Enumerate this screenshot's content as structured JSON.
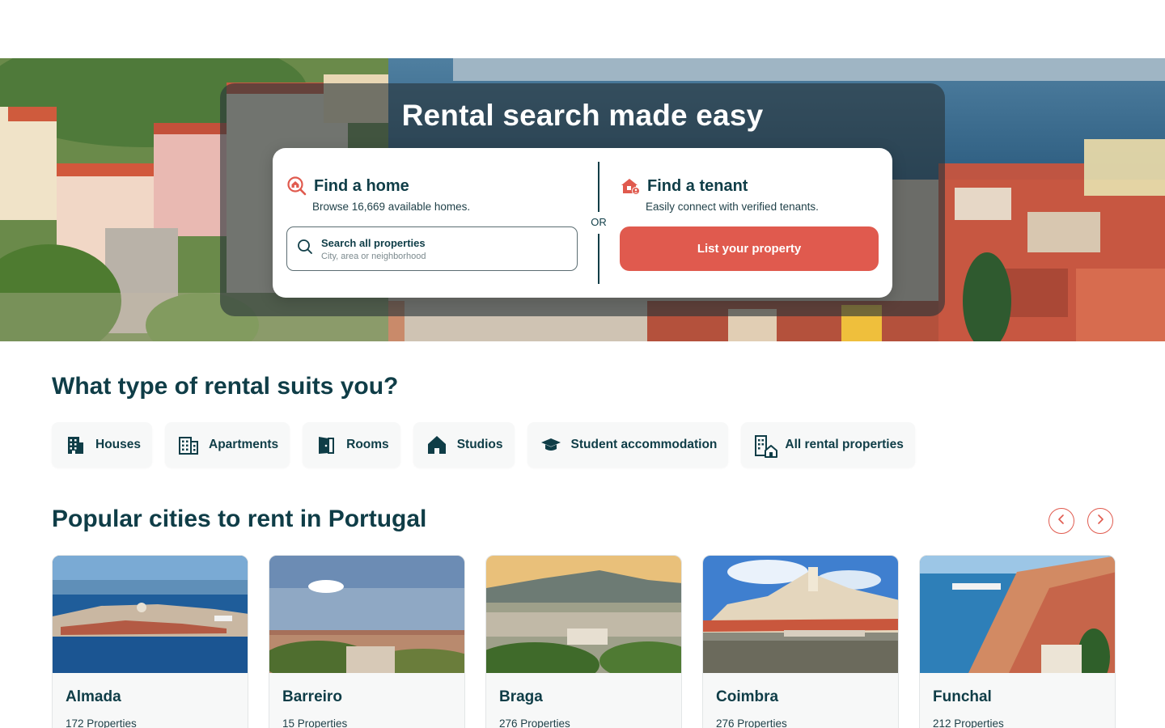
{
  "hero": {
    "title": "Rental search made easy",
    "find_home": {
      "title": "Find a home",
      "subtitle": "Browse 16,669 available homes.",
      "icon": "house-search-icon"
    },
    "search": {
      "label": "Search all properties",
      "placeholder": "City, area or neighborhood",
      "icon": "search-icon"
    },
    "or_label": "OR",
    "find_tenant": {
      "title": "Find a tenant",
      "subtitle": "Easily connect with verified tenants.",
      "icon": "house-user-icon",
      "button_label": "List your property"
    }
  },
  "rental_types": {
    "title": "What type of rental suits you?",
    "items": [
      {
        "label": "Houses",
        "icon": "house-building-icon"
      },
      {
        "label": "Apartments",
        "icon": "apartment-building-icon"
      },
      {
        "label": "Rooms",
        "icon": "door-icon"
      },
      {
        "label": "Studios",
        "icon": "home-icon"
      },
      {
        "label": "Student accommodation",
        "icon": "graduation-cap-icon"
      },
      {
        "label": "All rental properties",
        "icon": "buildings-icon"
      }
    ]
  },
  "cities": {
    "title": "Popular cities to rent in Portugal",
    "prev_icon": "chevron-left-icon",
    "next_icon": "chevron-right-icon",
    "items": [
      {
        "name": "Almada",
        "count": "172 Properties"
      },
      {
        "name": "Barreiro",
        "count": "15 Properties"
      },
      {
        "name": "Braga",
        "count": "276 Properties"
      },
      {
        "name": "Coimbra",
        "count": "276 Properties"
      },
      {
        "name": "Funchal",
        "count": "212 Properties"
      }
    ]
  },
  "colors": {
    "brand_dark": "#0f3d47",
    "accent": "#e05a4e",
    "chip_bg": "#f7f8f8"
  }
}
